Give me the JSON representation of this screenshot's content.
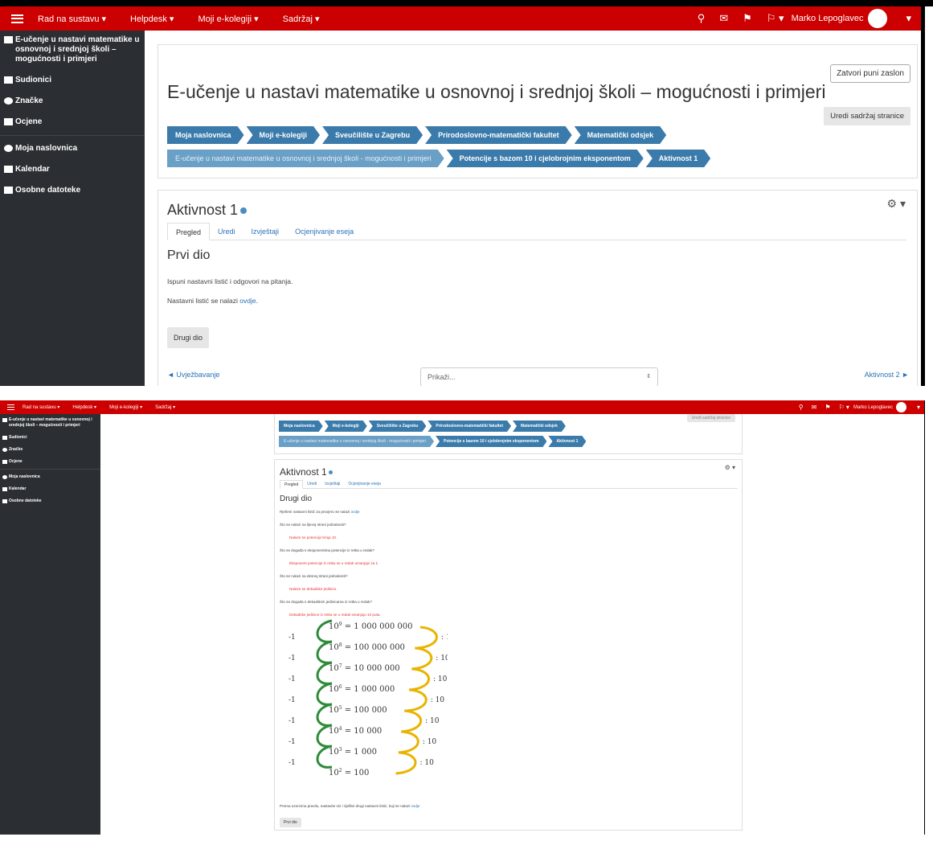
{
  "navbar": {
    "items": [
      "Rad na sustavu ▾",
      "Helpdesk ▾",
      "Moji e-kolegiji ▾",
      "Sadržaj ▾"
    ],
    "user_name": "Marko Lepoglavec",
    "icons": [
      "search-icon",
      "envelope-icon",
      "bell-icon",
      "flag-icon",
      "caret-down-icon"
    ]
  },
  "sidebar": {
    "course": "E-učenje u nastavi matematike u osnovnoj i srednjoj školi – mogućnosti i primjeri",
    "items": [
      "Sudionici",
      "Značke",
      "Ocjene"
    ],
    "items2": [
      "Moja naslovnica",
      "Kalendar",
      "Osobne datoteke"
    ]
  },
  "header": {
    "fullscreen": "Zatvori puni zaslon",
    "title": "E-učenje u nastavi matematike u osnovnoj i srednjoj školi – mogućnosti i primjeri",
    "edit_page": "Uredi sadržaj stranice",
    "breadcrumb1": [
      "Moja naslovnica",
      "Moji e-kolegiji",
      "Sveučilište u Zagrebu",
      "Prirodoslovno-matematički fakultet",
      "Matematički odsjek"
    ],
    "breadcrumb2": [
      "E-učenje u nastavi matematike u osnovnoj i srednjoj školi - mogućnosti i primjeri",
      "Potencije s bazom 10 i cjelobrojnim eksponentom",
      "Aktivnost 1"
    ]
  },
  "activity": {
    "title": "Aktivnost 1",
    "tabs": [
      "Pregled",
      "Uredi",
      "Izvještaji",
      "Ocjenjivanje eseja"
    ]
  },
  "page1": {
    "section": "Prvi dio",
    "p1": "Ispuni nastavni listić i odgovori na pitanja.",
    "p2_prefix": "Nastavni listić se nalazi ",
    "p2_link": "ovdje",
    "p2_suffix": ".",
    "next_button": "Drugi dio",
    "prev_link": "◄ Uvježbavanje",
    "jump_placeholder": "Prikaži...",
    "next_link": "Aktivnost 2 ►"
  },
  "page2": {
    "section": "Drugi dio",
    "qa": [
      {
        "text": "Rješeni nastavni listić za provjeru se nalazi ",
        "link": "ovdje",
        "answer": false
      },
      {
        "text": "Što se nalazi na lijevoj strani jednakosti?",
        "link": "",
        "answer": false
      },
      {
        "text": "Nalaze se potencije broja 10.",
        "link": "",
        "answer": true
      },
      {
        "text": "Što se događa s eksponentima potencije iz retka u redak?",
        "link": "",
        "answer": false
      },
      {
        "text": "Eksponent potencije iz retka se u redak umanjuje za 1.",
        "link": "",
        "answer": true
      },
      {
        "text": "Što se nalazi na desnoj strani jednakosti?",
        "link": "",
        "answer": false
      },
      {
        "text": "Nalaze se dekadske jedinice.",
        "link": "",
        "answer": true
      },
      {
        "text": "Što se događa s dekadskim jedinicama iz retka u redak?",
        "link": "",
        "answer": false
      },
      {
        "text": "Dekadske jedinice iz retka se u redak smanjuju 10 puta.",
        "link": "",
        "answer": true
      }
    ],
    "figure": {
      "left_label": "-1",
      "right_label": ": 10",
      "rows": [
        {
          "exp": "9",
          "value": "1 000 000 000"
        },
        {
          "exp": "8",
          "value": "100 000 000"
        },
        {
          "exp": "7",
          "value": "10 000 000"
        },
        {
          "exp": "6",
          "value": "1 000 000"
        },
        {
          "exp": "5",
          "value": "100 000"
        },
        {
          "exp": "4",
          "value": "10 000"
        },
        {
          "exp": "3",
          "value": "1 000"
        },
        {
          "exp": "2",
          "value": "100"
        }
      ],
      "base": "10",
      "colors": {
        "left_arc": "#2e8b3a",
        "right_arc": "#e8b400"
      }
    },
    "footer_text": "Prema uzorcima pravilu, nastavite niz i riješite drugi nastavni listić, koji se nalazi ",
    "footer_link": "ovdje",
    "prev_button": "Prvi dio"
  },
  "colors": {
    "navbar": "#cc0000",
    "sidebar": "#2b2f33",
    "breadcrumb": "#3a7bab",
    "answer": "#e53333"
  }
}
